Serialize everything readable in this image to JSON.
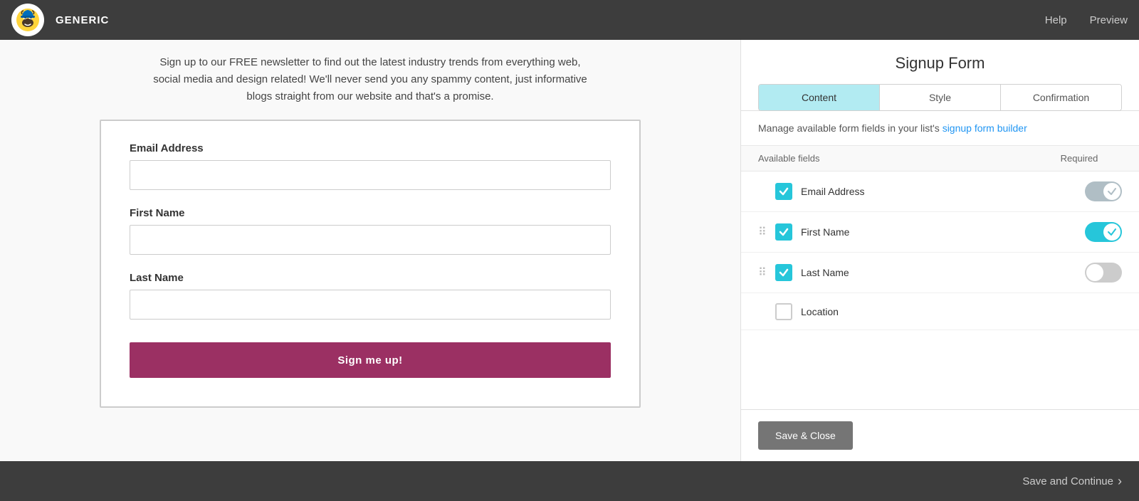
{
  "topbar": {
    "brand": "GENERIC",
    "nav_help": "Help",
    "nav_preview": "Preview"
  },
  "preview": {
    "description": "Sign up to our FREE newsletter to find out the latest industry trends from everything web, social media and design related! We'll never send you any spammy content, just informative blogs straight from our website and that's a promise.",
    "fields": [
      {
        "label": "Email Address",
        "placeholder": ""
      },
      {
        "label": "First Name",
        "placeholder": ""
      },
      {
        "label": "Last Name",
        "placeholder": ""
      }
    ],
    "submit_label": "Sign me up!"
  },
  "panel": {
    "title": "Signup Form",
    "tabs": [
      {
        "label": "Content",
        "active": true
      },
      {
        "label": "Style",
        "active": false
      },
      {
        "label": "Confirmation",
        "active": false
      }
    ],
    "info_text": "Manage available form fields in your list's",
    "info_link": "signup form builder",
    "fields_header": {
      "available": "Available fields",
      "required": "Required"
    },
    "fields": [
      {
        "name": "Email Address",
        "checked": true,
        "required_on": false,
        "required_disabled": true,
        "show_drag": false
      },
      {
        "name": "First Name",
        "checked": true,
        "required_on": true,
        "required_disabled": false,
        "show_drag": true
      },
      {
        "name": "Last Name",
        "checked": true,
        "required_on": false,
        "required_disabled": false,
        "show_drag": true
      },
      {
        "name": "Location",
        "checked": false,
        "required_on": false,
        "required_disabled": false,
        "show_drag": false
      }
    ],
    "save_close_label": "Save & Close"
  },
  "bottom_bar": {
    "save_continue_label": "Save and Continue"
  }
}
